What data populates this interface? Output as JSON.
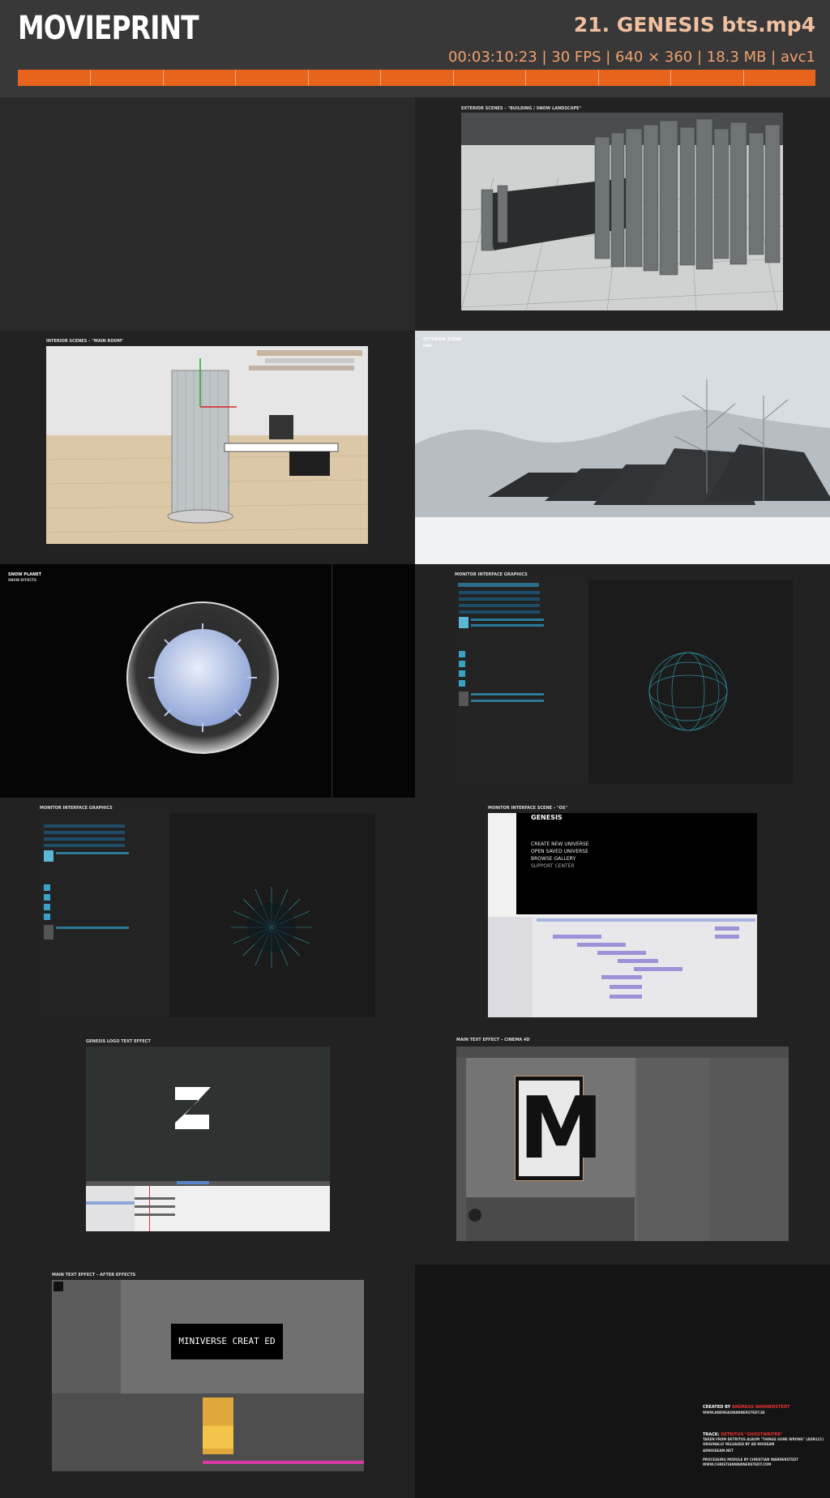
{
  "header": {
    "logo": "MOVIEPRINT",
    "file_title": "21. GENESIS bts.mp4",
    "meta": "00:03:10:23 | 30 FPS | 640 × 360 | 18.3 MB | avc1"
  },
  "thumbs": {
    "t2": {
      "label": "EXTERIOR SCENES – \"BUILDING / SNOW LANDSCAPE\""
    },
    "t3": {
      "label": "INTERIOR SCENES – \"MAIN ROOM\""
    },
    "t4": {
      "label": "EXTERIOR SCENE",
      "sub": "RAW"
    },
    "t5": {
      "label": "SNOW PLANET",
      "sub": "SNOW EFFECTS"
    },
    "t6": {
      "label": "MONITOR INTERFACE GRAPHICS"
    },
    "t7": {
      "label": "MONITOR INTERFACE GRAPHICS"
    },
    "t8": {
      "label": "MONITOR INTERFACE SCENE – \"OS\"",
      "brand": "GENESIS",
      "menu": [
        "CREATE NEW UNIVERSE",
        "OPEN SAVED UNIVERSE",
        "BROWSE GALLERY",
        "SUPPORT CENTER"
      ]
    },
    "t9": {
      "label": "GENESIS LOGO TEXT EFFECT"
    },
    "t10": {
      "label": "MAIN TEXT EFFECT – CINEMA 4D",
      "letter": "M"
    },
    "t11": {
      "label": "MAIN TEXT EFFECT – AFTER EFFECTS",
      "text": "MINIVERSE CREAT ED"
    },
    "t12": {
      "created_by_prefix": "CREATED BY ",
      "created_by_name": "ANDREAS WANNERSTEDT",
      "created_by_url": "WWW.ANDREASWANNERSTEDT.SE",
      "track_prefix": "TRACK: ",
      "track_name": "DETRITUS \"GHOSTWRITER\"",
      "track_line2": "TAKEN FROM DETRITUS ALBUM \"THINGS GONE WRONG\" (ADN121)",
      "track_line3": "ORIGINALLY RELEASED BY AD NOISEAM",
      "track_url": "ADNOISEAM.NET",
      "processing": "PROCESSING MODULE BY CHRISTIAN WANNERSTEDT",
      "processing_url": "WWW.CHRISTIANWANNERSTEDT.COM"
    }
  },
  "colors": {
    "accent": "#e8641d",
    "bg": "#2b2b2b",
    "header": "#383838"
  }
}
